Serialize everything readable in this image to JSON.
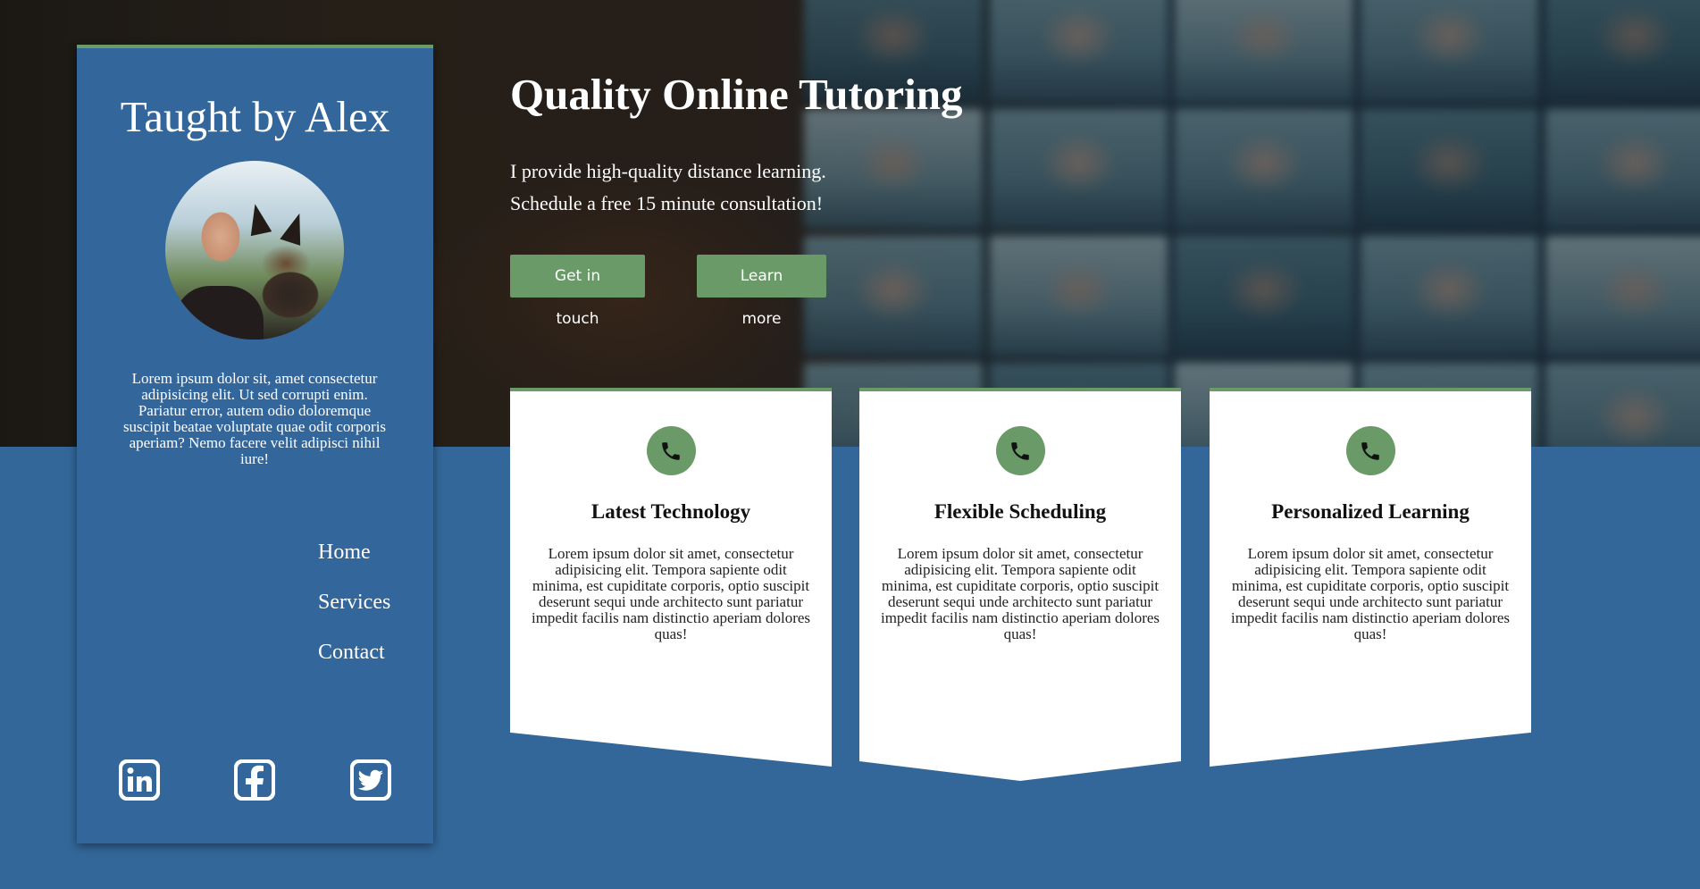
{
  "colors": {
    "primary_blue": "#33679a",
    "accent_green": "#6a9a67",
    "card_bg": "#ffffff",
    "text_light": "#ffffff"
  },
  "sidebar": {
    "title": "Taught by Alex",
    "avatar_alt": "Alex with a dog",
    "bio": "Lorem ipsum dolor sit, amet consectetur adipisicing elit. Ut sed corrupti enim. Pariatur error, autem odio doloremque suscipit beatae voluptate quae odit corporis aperiam? Nemo facere velit adipisci nihil iure!",
    "nav": [
      {
        "label": "Home"
      },
      {
        "label": "Services"
      },
      {
        "label": "Contact"
      }
    ],
    "socials": [
      {
        "icon": "linkedin-icon"
      },
      {
        "icon": "facebook-icon"
      },
      {
        "icon": "twitter-icon"
      }
    ]
  },
  "hero": {
    "headline": "Quality Online Tutoring",
    "lead_line1": "I provide high-quality distance learning.",
    "lead_line2": "Schedule a free 15 minute consultation!",
    "buttons": {
      "contact": "Get in touch",
      "learn": "Learn more"
    }
  },
  "features": [
    {
      "icon": "phone-icon",
      "title": "Latest Technology",
      "text": "Lorem ipsum dolor sit amet, consectetur adipisicing elit. Tempora sapiente odit minima, est cupiditate corporis, optio suscipit deserunt sequi unde architecto sunt pariatur impedit facilis nam distinctio aperiam dolores quas!"
    },
    {
      "icon": "phone-icon",
      "title": "Flexible Scheduling",
      "text": "Lorem ipsum dolor sit amet, consectetur adipisicing elit. Tempora sapiente odit minima, est cupiditate corporis, optio suscipit deserunt sequi unde architecto sunt pariatur impedit facilis nam distinctio aperiam dolores quas!"
    },
    {
      "icon": "phone-icon",
      "title": "Personalized Learning",
      "text": "Lorem ipsum dolor sit amet, consectetur adipisicing elit. Tempora sapiente odit minima, est cupiditate corporis, optio suscipit deserunt sequi unde architecto sunt pariatur impedit facilis nam distinctio aperiam dolores quas!"
    }
  ]
}
